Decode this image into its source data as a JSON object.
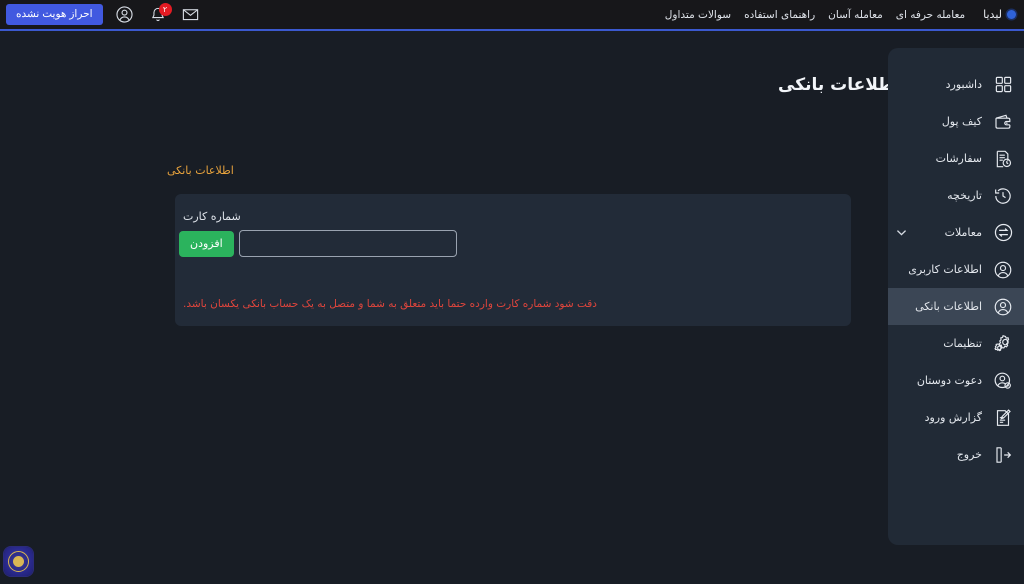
{
  "header": {
    "brand_name": "لیدیا",
    "nav_items": [
      {
        "label": "معامله حرفه ای",
        "name": "nav-pro-trade"
      },
      {
        "label": "معامله آسان",
        "name": "nav-easy-trade"
      },
      {
        "label": "راهنمای استفاده",
        "name": "nav-user-guide"
      },
      {
        "label": "سوالات متداول",
        "name": "nav-faq"
      }
    ],
    "verify_button_label": "احراز هویت نشده",
    "notification_count": "۲",
    "icons": {
      "user": "user-circle-icon",
      "bell": "bell-icon",
      "mail": "envelope-icon"
    }
  },
  "sidebar": {
    "items": [
      {
        "label": "داشبورد",
        "icon": "dashboard-grid-icon",
        "active": false,
        "caret": false
      },
      {
        "label": "کیف پول",
        "icon": "wallet-icon",
        "active": false,
        "caret": false
      },
      {
        "label": "سفارشات",
        "icon": "orders-list-icon",
        "active": false,
        "caret": false
      },
      {
        "label": "تاریخچه",
        "icon": "history-clock-icon",
        "active": false,
        "caret": false
      },
      {
        "label": "معاملات",
        "icon": "exchange-arrows-icon",
        "active": false,
        "caret": true
      },
      {
        "label": "اطلاعات کاربری",
        "icon": "user-circle-icon",
        "active": false,
        "caret": false
      },
      {
        "label": "اطلاعات بانکی",
        "icon": "user-circle-icon",
        "active": true,
        "caret": false
      },
      {
        "label": "تنظیمات",
        "icon": "gear-icon",
        "active": false,
        "caret": false
      },
      {
        "label": "دعوت دوستان",
        "icon": "invite-friends-icon",
        "active": false,
        "caret": false
      },
      {
        "label": "گزارش ورود",
        "icon": "login-report-icon",
        "active": false,
        "caret": false
      },
      {
        "label": "خروج",
        "icon": "logout-icon",
        "active": false,
        "caret": false
      }
    ]
  },
  "main": {
    "page_title": "اطلاعات بانکی",
    "section_title": "اطلاعات بانکی",
    "form": {
      "card_number_label": "شماره کارت",
      "card_number_value": "",
      "card_number_placeholder": "",
      "add_button_label": "افزودن"
    },
    "warning_note": "دقت شود شماره کارت وارده حتما باید متعلق به شما و متصل به یک حساب بانکی یکسان باشد."
  },
  "footer": {
    "trust_seal_name": "enamad-trust-seal"
  },
  "colors": {
    "page_bg": "#181d25",
    "header_bg": "#17171a",
    "header_accent": "#3b59cf",
    "sidebar_bg": "#212a36",
    "sidebar_active": "#3b4655",
    "card_bg": "#222b38",
    "accent_green": "#2bb35d",
    "accent_blue": "#4159e0",
    "warning_red": "#e0453c",
    "section_gold": "#e8a33d"
  }
}
